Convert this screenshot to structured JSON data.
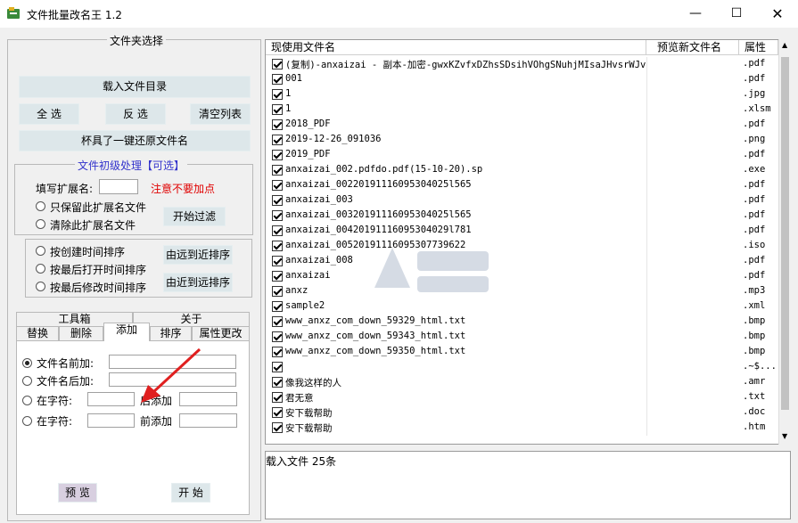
{
  "window": {
    "title": "文件批量改名王  1.2"
  },
  "left": {
    "folder_group_title": "文件夹选择",
    "load_button": "载入文件目录",
    "select_all": "全 选",
    "invert": "反 选",
    "clear_list": "清空列表",
    "restore_button": "杯具了一键还原文件名",
    "filter_group_title": "文件初级处理【可选】",
    "ext_label": "填写扩展名:",
    "ext_value": "",
    "ext_warning": "注意不要加点",
    "keep_ext": "只保留此扩展名文件",
    "remove_ext": "清除此扩展名文件",
    "start_filter": "开始过滤",
    "sort_by_create": "按创建时间排序",
    "sort_by_open": "按最后打开时间排序",
    "sort_by_modify": "按最后修改时间排序",
    "far_to_near": "由远到近排序",
    "near_to_far": "由近到远排序"
  },
  "tabs": {
    "row1": [
      "工具箱",
      "关于"
    ],
    "row2": [
      "替换",
      "删除",
      "添加",
      "排序",
      "属性更改"
    ],
    "active": "添加"
  },
  "add_panel": {
    "prefix_label": "文件名前加:",
    "suffix_label": "文件名后加:",
    "at_char_label1": "在字符:",
    "after_add": "后添加",
    "at_char_label2": "在字符:",
    "before_add": "前添加",
    "preview": "预 览",
    "start": "开 始"
  },
  "list": {
    "headers": [
      "现使用文件名",
      "预览新文件名",
      "属性"
    ],
    "rows": [
      {
        "name": "(复制)-anxaizai - 副本-加密-gwxKZvfxDZhsSDsihVOhgSNuhjMIsaJHvsrWJv",
        "ext": ".pdf"
      },
      {
        "name": "001",
        "ext": ".pdf"
      },
      {
        "name": "1",
        "ext": ".jpg"
      },
      {
        "name": "1",
        "ext": ".xlsm"
      },
      {
        "name": "2018_PDF",
        "ext": ".pdf"
      },
      {
        "name": "2019-12-26_091036",
        "ext": ".png"
      },
      {
        "name": "2019_PDF",
        "ext": ".pdf"
      },
      {
        "name": "anxaizai_002.pdfdo.pdf(15-10-20).sp",
        "ext": ".exe"
      },
      {
        "name": "anxaizai_00220191116095304025l565",
        "ext": ".pdf"
      },
      {
        "name": "anxaizai_003",
        "ext": ".pdf"
      },
      {
        "name": "anxaizai_00320191116095304025l565",
        "ext": ".pdf"
      },
      {
        "name": "anxaizai_00420191116095304029l781",
        "ext": ".pdf"
      },
      {
        "name": "anxaizai_00520191116095307739622",
        "ext": ".iso"
      },
      {
        "name": "anxaizai_008",
        "ext": ".pdf"
      },
      {
        "name": "anxaizai",
        "ext": ".pdf"
      },
      {
        "name": "anxz",
        "ext": ".mp3"
      },
      {
        "name": "sample2",
        "ext": ".xml"
      },
      {
        "name": "www_anxz_com_down_59329_html.txt",
        "ext": ".bmp"
      },
      {
        "name": "www_anxz_com_down_59343_html.txt",
        "ext": ".bmp"
      },
      {
        "name": "www_anxz_com_down_59350_html.txt",
        "ext": ".bmp"
      },
      {
        "name": "",
        "ext": ".~$..."
      },
      {
        "name": "像我这样的人",
        "ext": ".amr"
      },
      {
        "name": "君无意",
        "ext": ".txt"
      },
      {
        "name": "安下载帮助",
        "ext": ".doc"
      },
      {
        "name": "安下载帮助",
        "ext": ".htm"
      }
    ]
  },
  "log": {
    "text": "载入文件  25条"
  },
  "colors": {
    "button": "#dde7ea",
    "accent_blue": "#3333cc",
    "warning_red": "#e00000"
  }
}
